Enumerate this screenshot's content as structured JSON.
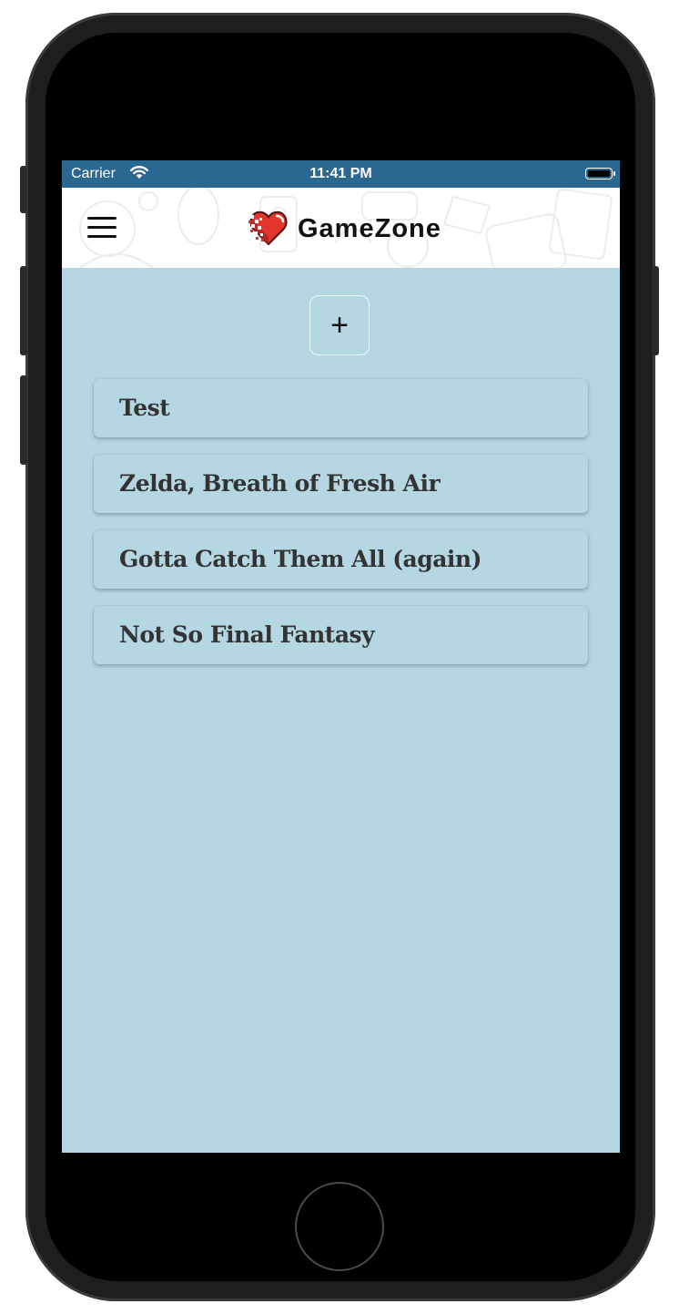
{
  "status_bar": {
    "carrier": "Carrier",
    "time": "11:41 PM",
    "wifi_icon": "wifi-icon",
    "battery_icon": "battery-icon"
  },
  "header": {
    "menu_icon": "hamburger-menu-icon",
    "logo_icon": "pixel-heart-icon",
    "title": "GameZone"
  },
  "add_button": {
    "label": "+"
  },
  "reviews": [
    {
      "title": "Test"
    },
    {
      "title": "Zelda, Breath of Fresh Air"
    },
    {
      "title": "Gotta Catch Them All (again)"
    },
    {
      "title": "Not So Final Fantasy"
    }
  ],
  "colors": {
    "status_bar": "#2b6891",
    "screen_background": "#b5d7e3",
    "header_background": "#ffffff",
    "card_text": "#333333",
    "heart_red": "#e2352c"
  }
}
